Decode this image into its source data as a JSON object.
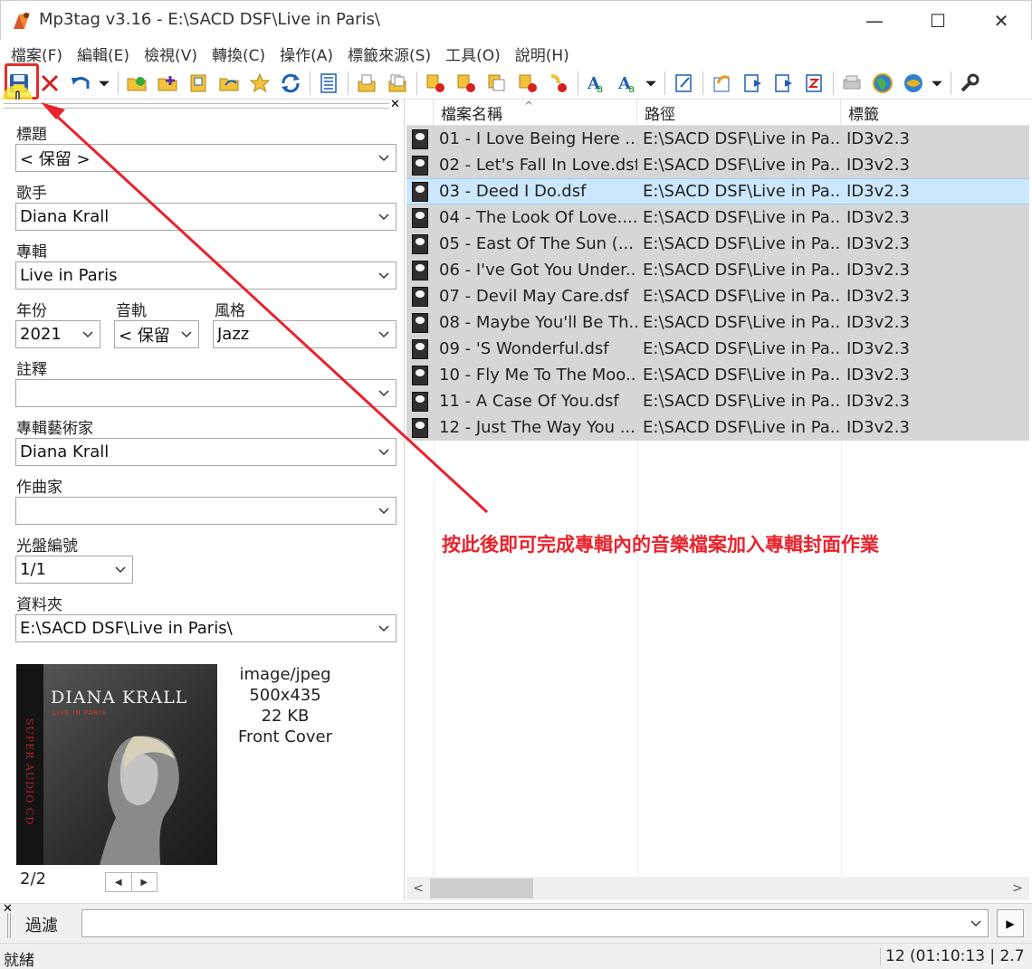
{
  "window": {
    "title": "Mp3tag v3.16  -  E:\\SACD DSF\\Live in Paris\\"
  },
  "menu": [
    "檔案(F)",
    "編輯(E)",
    "檢視(V)",
    "轉換(C)",
    "操作(A)",
    "標籤來源(S)",
    "工具(O)",
    "說明(H)"
  ],
  "toolbar": {
    "icons": [
      "save-icon",
      "remove-tag-icon",
      "undo-icon",
      "undo-dropdown-icon",
      "change-directory-icon",
      "add-directory-icon",
      "open-folder-icon",
      "favorite-folder-icon",
      "star-icon",
      "refresh-icon",
      "tag-panel-icon",
      "export-icon",
      "playlist-icon",
      "convert-tag-filename-icon",
      "convert-filename-tag-icon",
      "convert-text-tag-icon",
      "convert-tag-tag-icon",
      "convert-tag-text-icon",
      "auto-numbering-icon",
      "case-conversion-icon",
      "case-dropdown-icon",
      "edit-icon",
      "import-cover-icon",
      "export-list-icon",
      "text-file-icon",
      "sort-icon",
      "freedb-icon",
      "web-source-icon",
      "web-source-2-icon",
      "web-source-dropdown-icon",
      "options-icon"
    ]
  },
  "tag_panel": {
    "title": {
      "label": "標題",
      "value": "< 保留 >"
    },
    "artist": {
      "label": "歌手",
      "value": "Diana Krall"
    },
    "album": {
      "label": "專輯",
      "value": "Live in Paris"
    },
    "year": {
      "label": "年份",
      "value": "2021"
    },
    "track": {
      "label": "音軌",
      "value": "< 保留"
    },
    "genre": {
      "label": "風格",
      "value": "Jazz"
    },
    "comment": {
      "label": "註釋",
      "value": ""
    },
    "album_artist": {
      "label": "專輯藝術家",
      "value": "Diana Krall"
    },
    "composer": {
      "label": "作曲家",
      "value": ""
    },
    "disc": {
      "label": "光盤編號",
      "value": "1/1"
    },
    "folder": {
      "label": "資料夾",
      "value": "E:\\SACD DSF\\Live in Paris\\"
    },
    "cover": {
      "artist_text": "DIANA KRALL",
      "album_text": "LIVE IN PARIS",
      "side_text": "SUPER AUDIO CD",
      "mime": "image/jpeg",
      "dimensions": "500x435",
      "size": "22 KB",
      "type": "Front Cover",
      "index": "2/2"
    }
  },
  "file_list": {
    "columns": [
      "檔案名稱",
      "路徑",
      "標籤"
    ],
    "rows": [
      {
        "name": "01 - I Love Being Here ...",
        "path": "E:\\SACD DSF\\Live in Pa...",
        "tag": "ID3v2.3",
        "state": "selected"
      },
      {
        "name": "02 - Let's Fall In Love.dsf",
        "path": "E:\\SACD DSF\\Live in Pa...",
        "tag": "ID3v2.3",
        "state": "selected"
      },
      {
        "name": "03 - Deed I Do.dsf",
        "path": "E:\\SACD DSF\\Live in Pa...",
        "tag": "ID3v2.3",
        "state": "focused"
      },
      {
        "name": "04 - The Look Of Love....",
        "path": "E:\\SACD DSF\\Live in Pa...",
        "tag": "ID3v2.3",
        "state": "selected"
      },
      {
        "name": "05 - East Of The Sun (...",
        "path": "E:\\SACD DSF\\Live in Pa...",
        "tag": "ID3v2.3",
        "state": "selected"
      },
      {
        "name": "06 - I've Got You Under...",
        "path": "E:\\SACD DSF\\Live in Pa...",
        "tag": "ID3v2.3",
        "state": "selected"
      },
      {
        "name": "07 - Devil May Care.dsf",
        "path": "E:\\SACD DSF\\Live in Pa...",
        "tag": "ID3v2.3",
        "state": "selected"
      },
      {
        "name": "08 - Maybe You'll Be Th...",
        "path": "E:\\SACD DSF\\Live in Pa...",
        "tag": "ID3v2.3",
        "state": "selected"
      },
      {
        "name": "09 - 'S Wonderful.dsf",
        "path": "E:\\SACD DSF\\Live in Pa...",
        "tag": "ID3v2.3",
        "state": "selected"
      },
      {
        "name": "10 - Fly Me To The Moo...",
        "path": "E:\\SACD DSF\\Live in Pa...",
        "tag": "ID3v2.3",
        "state": "selected"
      },
      {
        "name": "11 - A Case Of You.dsf",
        "path": "E:\\SACD DSF\\Live in Pa...",
        "tag": "ID3v2.3",
        "state": "selected"
      },
      {
        "name": "12 - Just The Way You ...",
        "path": "E:\\SACD DSF\\Live in Pa...",
        "tag": "ID3v2.3",
        "state": "selected"
      }
    ]
  },
  "filter": {
    "label": "過濾",
    "value": ""
  },
  "status": {
    "left": "就緒",
    "right": "12 (01:10:13 | 2.7"
  },
  "annotation": {
    "text": "按此後即可完成專輯內的音樂檔案加入專輯封面作業",
    "color": "#e8232d"
  },
  "colors": {
    "selected_row": "#d6d6d6",
    "focused_row": "#cce8ff",
    "accent": "#e52b2b"
  }
}
